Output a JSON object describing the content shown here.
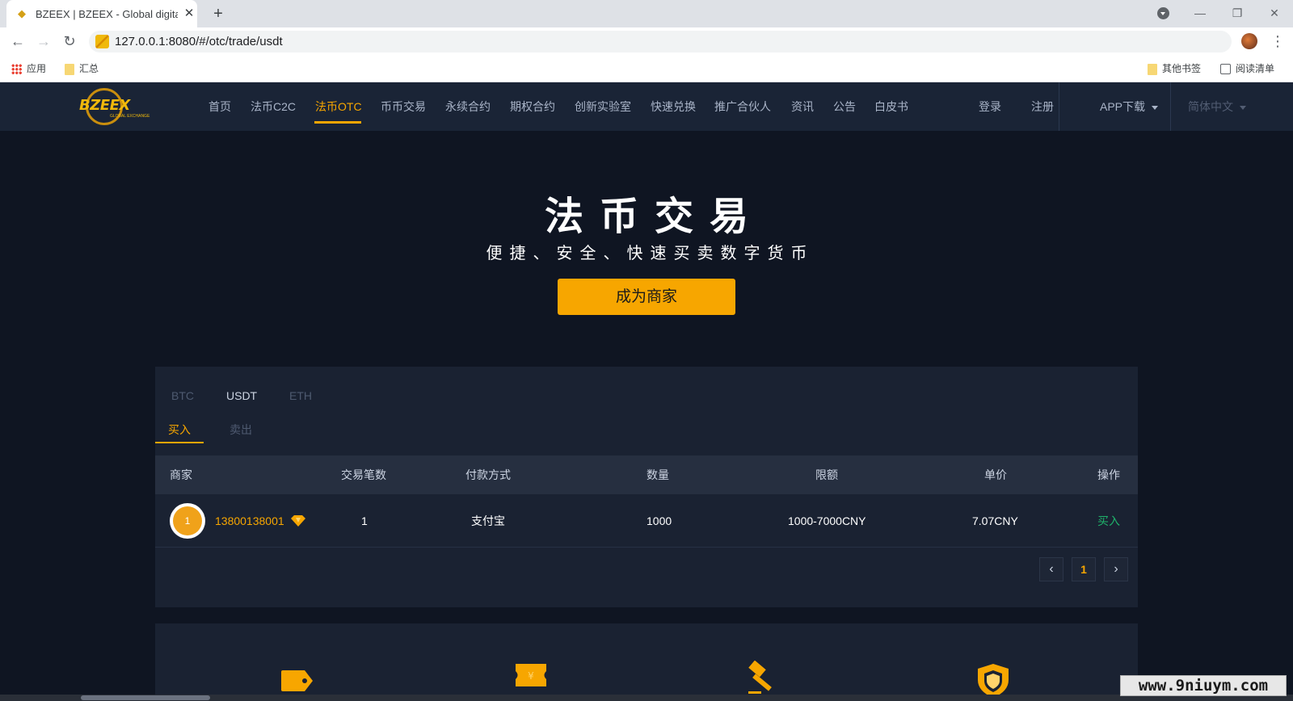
{
  "browser": {
    "tab_title": "BZEEX | BZEEX - Global digital",
    "url": "127.0.0.1:8080/#/otc/trade/usdt",
    "bookmarks": {
      "apps": "应用",
      "folder": "汇总",
      "other": "其他书签",
      "reading_list": "阅读清单"
    }
  },
  "header": {
    "logo_text": "BZEEX",
    "logo_sub": "GLOBAL EXCHANGE",
    "nav": [
      "首页",
      "法币C2C",
      "法币OTC",
      "币币交易",
      "永续合约",
      "期权合约",
      "创新实验室",
      "快速兑换",
      "推广合伙人",
      "资讯",
      "公告",
      "白皮书"
    ],
    "active_nav": "法币OTC",
    "login": "登录",
    "register": "注册",
    "app_download": "APP下载",
    "language": "简体中文"
  },
  "hero": {
    "title": "法币交易",
    "subtitle": "便捷、安全、快速买卖数字货币",
    "cta": "成为商家"
  },
  "trade": {
    "coins": [
      "BTC",
      "USDT",
      "ETH"
    ],
    "active_coin": "USDT",
    "sides": [
      "买入",
      "卖出"
    ],
    "active_side": "买入",
    "columns": [
      "商家",
      "交易笔数",
      "付款方式",
      "数量",
      "限额",
      "单价",
      "操作"
    ],
    "rows": [
      {
        "avatar": "1",
        "merchant": "13800138001",
        "trades": "1",
        "payment": "支付宝",
        "quantity": "1000",
        "limit": "1000-7000CNY",
        "price": "7.07CNY",
        "action": "买入"
      }
    ],
    "pagination": {
      "prev": "‹",
      "current": "1",
      "next": "›"
    }
  },
  "watermark": "www.9niuym.com",
  "colors": {
    "accent": "#f7a600",
    "buy": "#1fb36b",
    "bg": "#0f1522",
    "panel": "#1a2232"
  }
}
